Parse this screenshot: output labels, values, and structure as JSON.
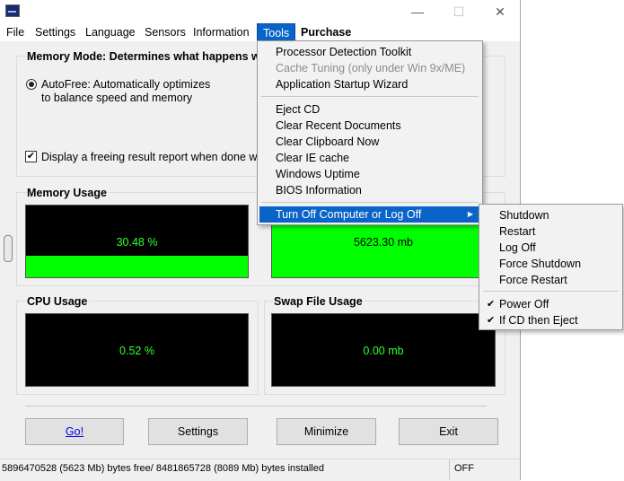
{
  "window": {
    "minimize": "—",
    "maximize": "☐",
    "close": "✕"
  },
  "menu": [
    "File",
    "Settings",
    "Language",
    "Sensors",
    "Information",
    "Tools",
    "Purchase"
  ],
  "memory_mode": {
    "title": "Memory Mode: Determines what happens whe",
    "option1": "AutoFree: Automatically optimizes",
    "option1_line2": "to balance speed and memory",
    "report_check": "Display a freeing result report when done wi"
  },
  "memory_usage": {
    "title": "Memory Usage",
    "percent_text": "30.48 %",
    "fraction": 0.3048,
    "free_text": "5623.30 mb"
  },
  "cpu_usage": {
    "title": "CPU Usage",
    "value": "0.52 %"
  },
  "swap_usage": {
    "title": "Swap File Usage",
    "value": "0.00 mb"
  },
  "buttons": {
    "go": "Go!",
    "settings": "Settings",
    "minimize": "Minimize",
    "exit": "Exit"
  },
  "status": {
    "left": "5896470528 (5623 Mb) bytes free/ 8481865728 (8089 Mb) bytes installed",
    "right": "OFF"
  },
  "tools_menu": [
    {
      "label": "Processor Detection Toolkit",
      "disabled": false
    },
    {
      "label": "Cache Tuning (only under Win 9x/ME)",
      "disabled": true
    },
    {
      "label": "Application Startup Wizard",
      "disabled": false
    },
    {
      "label": "Eject CD",
      "disabled": false
    },
    {
      "label": "Clear Recent Documents",
      "disabled": false
    },
    {
      "label": "Clear Clipboard Now",
      "disabled": false
    },
    {
      "label": "Clear IE cache",
      "disabled": false
    },
    {
      "label": "Windows Uptime",
      "disabled": false
    },
    {
      "label": "BIOS Information",
      "disabled": false
    },
    {
      "label": "Turn Off Computer or Log Off",
      "disabled": false
    }
  ],
  "submenu": [
    {
      "label": "Shutdown",
      "checked": false
    },
    {
      "label": "Restart",
      "checked": false
    },
    {
      "label": "Log Off",
      "checked": false
    },
    {
      "label": "Force Shutdown",
      "checked": false
    },
    {
      "label": "Force Restart",
      "checked": false
    },
    {
      "label": "Power Off",
      "checked": true
    },
    {
      "label": "If CD then Eject",
      "checked": true
    }
  ],
  "colors": {
    "highlight": "#0a64c8",
    "meter_green": "#00ff00",
    "meter_text": "#33ff33"
  }
}
